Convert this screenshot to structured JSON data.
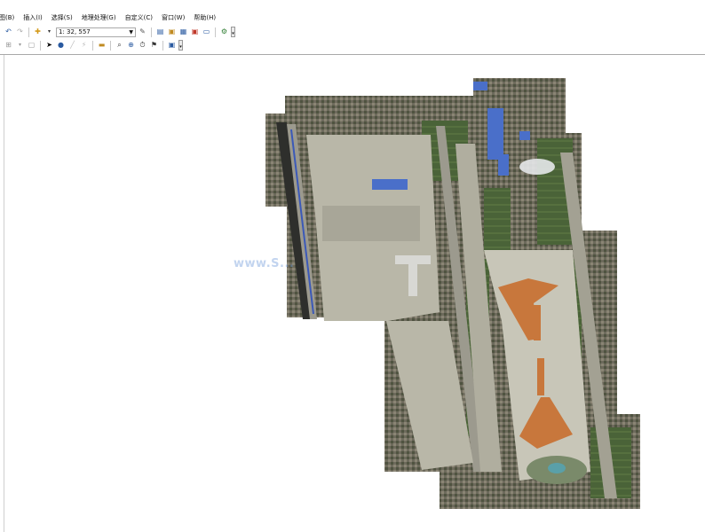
{
  "menu": [
    "图(B)",
    "插入(I)",
    "选择(S)",
    "地理处理(G)",
    "自定义(C)",
    "窗口(W)",
    "帮助(H)"
  ],
  "toolbar": {
    "scale_value": "1: 32, 557",
    "icons": [
      "undo-icon",
      "redo-icon",
      "add-data-icon",
      "scale-dropdown",
      "editor-icon",
      "catalog-icon",
      "table-icon",
      "layout-icon",
      "window-icon"
    ]
  },
  "map": {
    "watermark": "www.S..."
  },
  "colors": {
    "terminal_roof": "#c8773c",
    "blue_roofs": "#4a6fc9",
    "grass": "#3f5a33",
    "pavement": "#b9b7a8"
  }
}
